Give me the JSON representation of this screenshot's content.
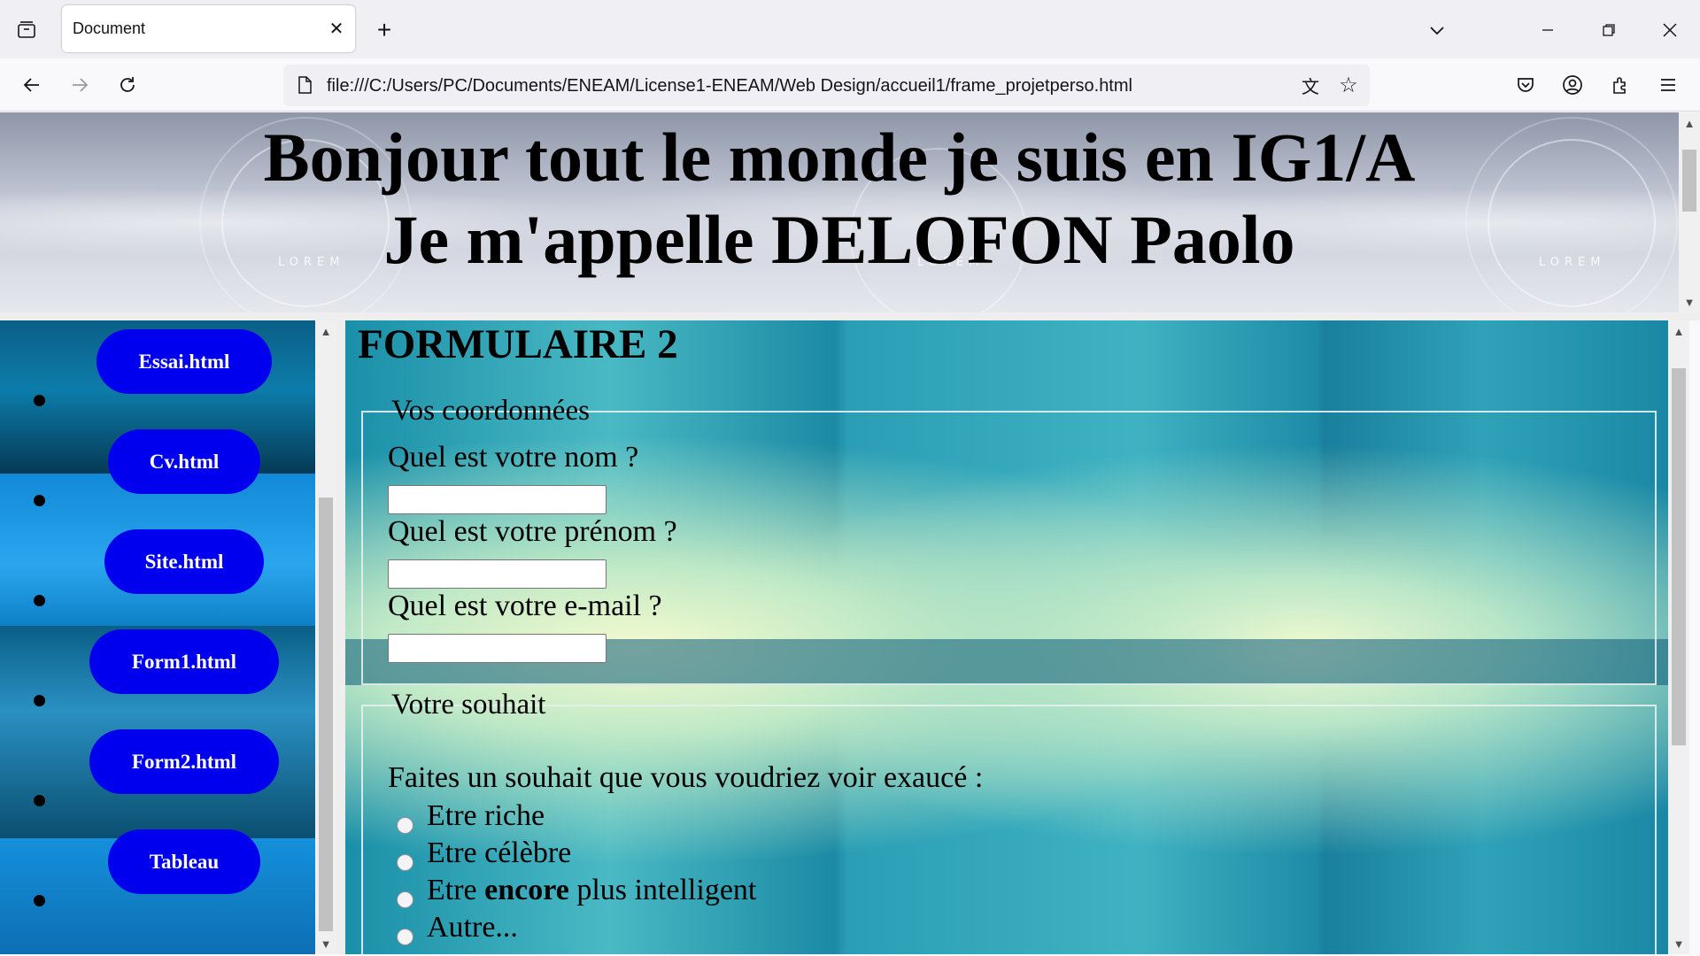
{
  "browser": {
    "tab_title": "Document",
    "url": "file:///C:/Users/PC/Documents/ENEAM/License1-ENEAM/Web Design/accueil1/frame_projetperso.html"
  },
  "header": {
    "line1": "Bonjour tout le monde je suis en IG1/A",
    "line2": "Je m'appelle DELOFON Paolo",
    "background_text": "LOREM"
  },
  "nav": {
    "items": [
      {
        "label": "Essai.html"
      },
      {
        "label": "Cv.html"
      },
      {
        "label": "Site.html"
      },
      {
        "label": "Form1.html"
      },
      {
        "label": "Form2.html"
      },
      {
        "label": "Tableau"
      }
    ]
  },
  "form": {
    "title": "FORMULAIRE 2",
    "coords": {
      "legend": "Vos coordonnées",
      "nom_label": "Quel est votre nom ?",
      "prenom_label": "Quel est votre prénom ?",
      "email_label": "Quel est votre e-mail ?",
      "nom_value": "",
      "prenom_value": "",
      "email_value": ""
    },
    "souhait": {
      "legend": "Votre souhait",
      "question": "Faites un souhait que vous voudriez voir exaucé :",
      "options": {
        "riche": "Etre riche",
        "celebre": "Etre célèbre",
        "intelligent_pre": "Etre",
        "intelligent_bold": "encore",
        "intelligent_post": "plus intelligent",
        "autre": "Autre..."
      }
    }
  },
  "colors": {
    "nav_button": "#0000ee",
    "nav_button_text": "#ffffff"
  },
  "icons": [
    "tab-list-icon",
    "close-icon",
    "new-tab-icon",
    "tab-overflow-icon",
    "minimize-icon",
    "restore-icon",
    "window-close-icon",
    "back-icon",
    "forward-icon",
    "reload-icon",
    "page-icon",
    "translate-icon",
    "bookmark-star-icon",
    "pocket-icon",
    "account-icon",
    "extensions-icon",
    "menu-icon"
  ]
}
